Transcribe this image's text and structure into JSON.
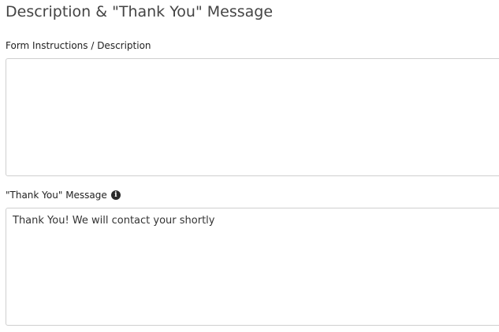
{
  "section": {
    "title": "Description & \"Thank You\" Message"
  },
  "fields": {
    "description": {
      "label": "Form Instructions / Description",
      "value": ""
    },
    "thank_you": {
      "label": "\"Thank You\" Message",
      "info_icon": "info-icon",
      "info_glyph": "i",
      "value": "Thank You! We will contact your shortly"
    }
  }
}
